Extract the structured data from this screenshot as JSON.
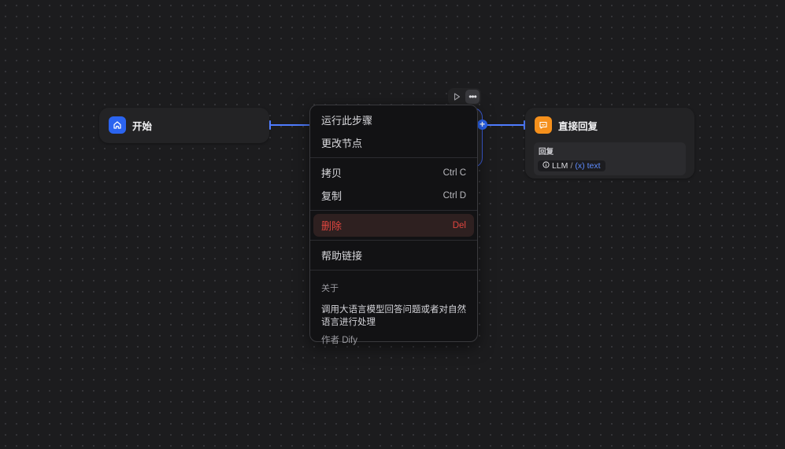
{
  "nodes": {
    "start": {
      "title": "开始",
      "icon": "home-icon",
      "color": "#2b64f0"
    },
    "answer": {
      "title": "直接回复",
      "icon": "reply-icon",
      "color": "#f5901c",
      "reply_label": "回复",
      "var_source": "LLM",
      "var_sep": "/",
      "var_symbol": "(x)",
      "var_name": "text"
    }
  },
  "toolbar": {
    "run_icon": "play-icon",
    "more_icon": "more-dots-icon"
  },
  "context_menu": {
    "run_step": "运行此步骤",
    "change_node": "更改节点",
    "copy": "拷贝",
    "copy_shortcut": "Ctrl C",
    "duplicate": "复制",
    "duplicate_shortcut": "Ctrl D",
    "delete": "删除",
    "delete_shortcut": "Del",
    "help_link": "帮助链接",
    "about_title": "关于",
    "about_desc": "调用大语言模型回答问题或者对自然语言进行处理",
    "author": "作者 Dify"
  },
  "colors": {
    "edge": "#4f7cff",
    "danger": "#e0453f",
    "accent": "#2b64f0"
  }
}
